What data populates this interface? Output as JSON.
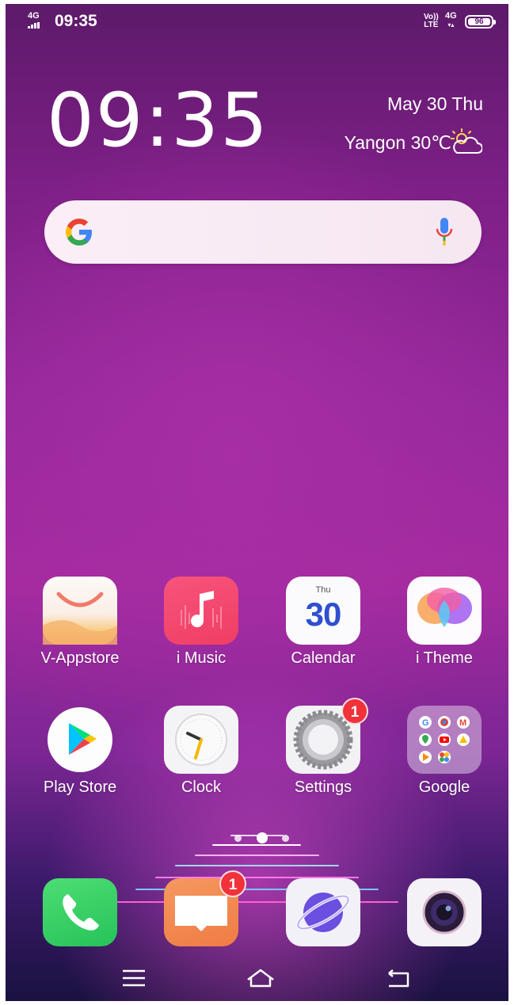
{
  "status_bar": {
    "network_left": "4G",
    "time": "09:35",
    "volte_top": "Vo))",
    "volte_bottom": "LTE",
    "network_right": "4G",
    "battery": "96"
  },
  "clock_widget": {
    "time": "09:35",
    "date": "May 30  Thu",
    "weather": "Yangon 30℃",
    "weather_icon": "partly-cloudy-icon"
  },
  "search_bar": {
    "logo": "google-g-icon",
    "mic": "mic-icon"
  },
  "apps_row1": [
    {
      "label": "V-Appstore",
      "icon": "vappstore-icon"
    },
    {
      "label": "i Music",
      "icon": "music-icon"
    },
    {
      "label": "Calendar",
      "icon": "calendar-icon",
      "day": "Thu",
      "date": "30"
    },
    {
      "label": "i Theme",
      "icon": "theme-icon"
    }
  ],
  "apps_row2": [
    {
      "label": "Play Store",
      "icon": "play-store-icon"
    },
    {
      "label": "Clock",
      "icon": "clock-icon"
    },
    {
      "label": "Settings",
      "icon": "settings-icon",
      "badge": "1"
    },
    {
      "label": "Google",
      "icon": "google-folder-icon"
    }
  ],
  "dock": [
    {
      "icon": "phone-icon"
    },
    {
      "icon": "messages-icon",
      "badge": "1"
    },
    {
      "icon": "browser-icon"
    },
    {
      "icon": "camera-icon"
    }
  ],
  "nav_bar": [
    "menu-icon",
    "home-icon",
    "back-icon"
  ],
  "colors": {
    "wallpaper_top": "#5d1a6a",
    "wallpaper_mid": "#a52aa0",
    "badge": "#f1323a"
  }
}
